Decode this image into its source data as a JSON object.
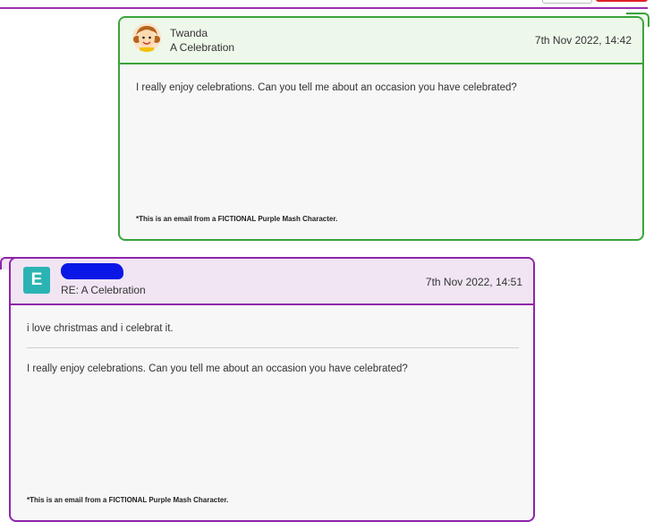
{
  "colors": {
    "green": "#3aa43a",
    "purple": "#8e24aa",
    "teal": "#2bb3b3"
  },
  "messages": [
    {
      "sender": "Twanda",
      "subject": "A Celebration",
      "date": "7th Nov 2022, 14:42",
      "body": "I really enjoy celebrations. Can you tell me about an occasion you have celebrated?",
      "footer": "*This is an email from a FICTIONAL Purple Mash Character.",
      "avatar_icon": "cartoon-character-icon"
    },
    {
      "avatar_letter": "E",
      "subject": "RE: A Celebration",
      "date": "7th Nov 2022, 14:51",
      "reply": "i love christmas and i celebrat it.",
      "quoted": "I really enjoy celebrations. Can you tell me about an occasion you have celebrated?",
      "footer": "*This is an email from a FICTIONAL Purple Mash Character."
    }
  ]
}
